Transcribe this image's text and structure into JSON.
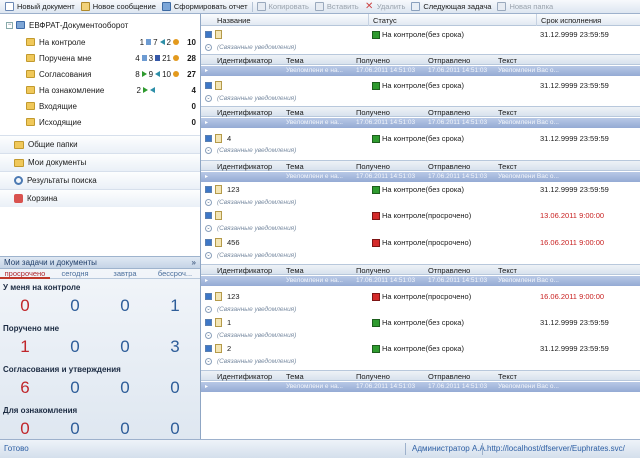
{
  "toolbar": {
    "new_document": "Новый документ",
    "new_message": "Новое сообщение",
    "generate_report": "Сформировать отчет",
    "copy": "Копировать",
    "paste": "Вставить",
    "delete": "Удалить",
    "next_task": "Следующая задача",
    "new_folder": "Новая папка"
  },
  "tree": {
    "root": "ЕВФРАТ-Документооборот",
    "items": [
      {
        "label": "На контроле",
        "a": "1",
        "b": "7",
        "c": "2",
        "total": "10"
      },
      {
        "label": "Поручена мне",
        "a": "4",
        "b": "3",
        "c": "21",
        "total": "28"
      },
      {
        "label": "Согласования",
        "a": "8",
        "b": "9",
        "c": "10",
        "total": "27"
      },
      {
        "label": "На ознакомление",
        "a": "2",
        "b": "",
        "c": "",
        "total": "4"
      },
      {
        "label": "Входящие",
        "a": "",
        "b": "",
        "c": "",
        "total": "0"
      },
      {
        "label": "Исходящие",
        "a": "",
        "b": "",
        "c": "",
        "total": "0"
      }
    ]
  },
  "nav": {
    "shared_folders": "Общие папки",
    "my_documents": "Мои документы",
    "search_results": "Результаты поиска",
    "recycle_bin": "Корзина"
  },
  "tasks": {
    "title": "Мои задачи и документы",
    "columns": [
      "просрочено",
      "сегодня",
      "завтра",
      "бессроч..."
    ],
    "sections": [
      {
        "title": "У меня на контроле",
        "values": [
          "0",
          "0",
          "0",
          "1"
        ]
      },
      {
        "title": "Поручено мне",
        "values": [
          "1",
          "0",
          "0",
          "3"
        ]
      },
      {
        "title": "Согласования и утверждения",
        "values": [
          "6",
          "0",
          "0",
          "0"
        ]
      },
      {
        "title": "Для ознакомления",
        "values": [
          "0",
          "0",
          "0",
          "0"
        ]
      }
    ]
  },
  "grid": {
    "headers": {
      "name": "Название",
      "status": "Статус",
      "deadline": "Срок исполнения"
    },
    "sub_headers": {
      "id": "Идентификатор",
      "topic": "Тема",
      "received": "Получено",
      "sent": "Отправлено",
      "text": "Текст"
    },
    "linked_text": "(Связанные уведомления)",
    "band_text": {
      "topic": "Увеломлени е на...",
      "received": "17.06.2011 14:51:03",
      "sent": "17.06.2011 14:51:03",
      "text": "Увеломлени Вас о..."
    },
    "rows": [
      {
        "name": "",
        "status": "На контроле(без срока)",
        "date": "31.12.9999 23:59:59",
        "overdue": false
      },
      {
        "name": "",
        "status": "На контроле(без срока)",
        "date": "31.12.9999 23:59:59",
        "overdue": false
      },
      {
        "name": "4",
        "status": "На контроле(без срока)",
        "date": "31.12.9999 23:59:59",
        "overdue": false
      },
      {
        "name": "123",
        "status": "На контроле(без срока)",
        "date": "31.12.9999 23:59:59",
        "overdue": false
      },
      {
        "name": "",
        "status": "На контроле(просрочено)",
        "date": "13.06.2011 9:00:00",
        "overdue": true
      },
      {
        "name": "456",
        "status": "На контроле(просрочено)",
        "date": "16.06.2011 9:00:00",
        "overdue": true
      },
      {
        "name": "123",
        "status": "На контроле(просрочено)",
        "date": "16.06.2011 9:00:00",
        "overdue": true
      },
      {
        "name": "1",
        "status": "На контроле(без срока)",
        "date": "31.12.9999 23:59:59",
        "overdue": false
      },
      {
        "name": "2",
        "status": "На контроле(без срока)",
        "date": "31.12.9999 23:59:59",
        "overdue": false
      }
    ]
  },
  "status_bar": {
    "state": "Готово",
    "user": "Администратор А.А.",
    "url": "http://localhost/dfserver/Euphrates.svc/"
  }
}
